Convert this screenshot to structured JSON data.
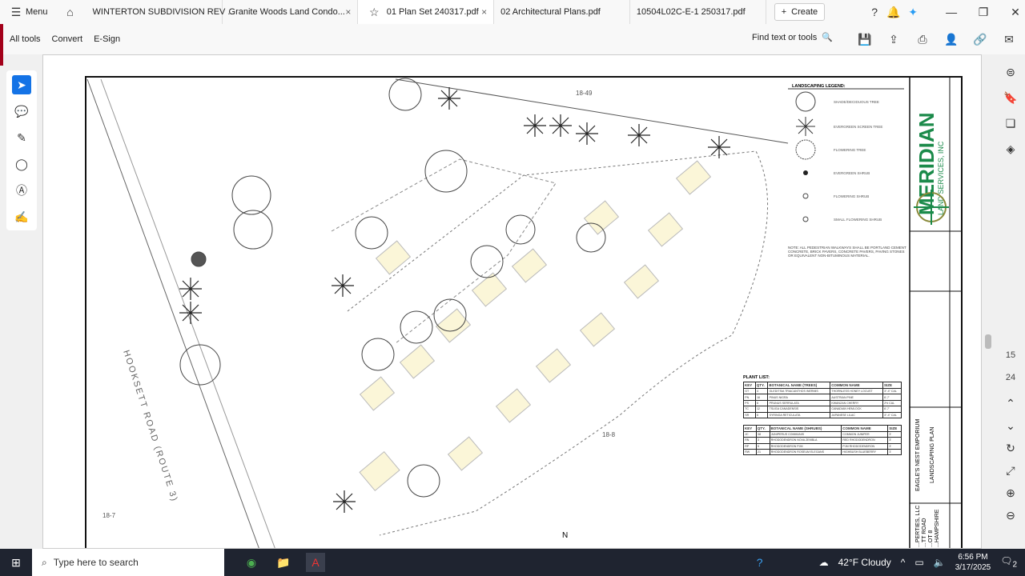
{
  "tabbar": {
    "menu": "Menu",
    "tabs": [
      {
        "label": "WINTERTON SUBDIVISION REV ...",
        "closable": false
      },
      {
        "label": "Granite Woods Land Condo...",
        "closable": true
      },
      {
        "label": "01 Plan Set 240317.pdf",
        "closable": true,
        "active": true
      },
      {
        "label": "02 Architectural Plans.pdf",
        "closable": false
      },
      {
        "label": "10504L02C-E-1 250317.pdf",
        "closable": false
      }
    ],
    "create": "Create",
    "close_glyph": "×"
  },
  "toolbar": {
    "all_tools": "All tools",
    "convert": "Convert",
    "esign": "E-Sign",
    "find": "Find text or tools"
  },
  "drawing": {
    "lot_labels": [
      "18-49",
      "18-8",
      "18-7"
    ],
    "road": "HOOKSETT ROAD (ROUTE 3)",
    "north": "N",
    "legend_title": "LANDSCAPING LEGEND:",
    "legend": [
      "SHADE/DECIDUOUS TREE",
      "EVERGREEN SCREEN TREE",
      "FLOWERING TREE",
      "EVERGREEN SHRUB",
      "FLOWERING SHRUB",
      "SMALL FLOWERING SHRUB"
    ],
    "note": "NOTE: ALL PEDESTRIAN WALKWAYS SHALL BE PORTLAND CEMENT CONCRETE, BRICK PAVERS, CONCRETE PAVERS, PAVING STONES OR EQUIVALENT NON-BITUMINOUS MATERIAL.",
    "plant_list_title": "PLANT LIST:",
    "trees_headers": [
      "KEY",
      "QTY.",
      "BOTANICAL NAME (TREES)",
      "COMMON NAME",
      "SIZE"
    ],
    "trees": [
      [
        "GT",
        "4",
        "GLEDITSIA TRIACANTHOS INERMIS",
        "THORNLESS HONEY LOCUST",
        "3\"-4\" CAL"
      ],
      [
        "PN",
        "18",
        "PINUS NIGRA",
        "AUSTRIAN PINE",
        "6'-7'"
      ],
      [
        "PS",
        "6",
        "PRUNUS SERRULATA",
        "KWANZAN CHERRY",
        "2½ CAL"
      ],
      [
        "TC",
        "12",
        "TSUGA CANADENSIS",
        "CANADIAN HEMLOCK",
        "6'-7'"
      ],
      [
        "SR",
        "6",
        "SYRINGA RETICULATA",
        "JAPANESE LILAC",
        "3\"-4\" CAL"
      ]
    ],
    "shrubs_headers": [
      "KEY",
      "QTY.",
      "BOTANICAL NAME (SHRUBS)",
      "COMMON NAME",
      "SIZE"
    ],
    "shrubs": [
      [
        "JC",
        "38",
        "JUNIPERUS COMMUNIS",
        "COMMON JUNIPER",
        "3'"
      ],
      [
        "RN",
        "3",
        "RHODODENDRON NOVA ZEMBLA",
        "RED RHODODENDRON",
        "3'"
      ],
      [
        "RP",
        "5",
        "RHODODENDRON PJM",
        "PJM RHODODENDRON",
        "3'"
      ],
      [
        "RW",
        "21",
        "RHODODENDRON ROSEUM ELEGANS",
        "HIGHBUSH BLUEBERRY",
        "3'"
      ]
    ],
    "company": "MERIDIAN",
    "company_sub": "LAND SERVICES, INC",
    "project": "EAGLE'S NEST EMPORIUM",
    "sheet": "LANDSCAPING PLAN",
    "owner_lines": [
      "...PERTIES, LLC",
      "...TT ROAD",
      "...OT 8",
      "...HAMPSHIRE"
    ]
  },
  "rightrail": {
    "current_page": "15",
    "total_pages": "24"
  },
  "taskbar": {
    "search": "Type here to search",
    "weather": "42°F  Cloudy",
    "time": "6:56 PM",
    "date": "3/17/2025",
    "notif": "2"
  }
}
